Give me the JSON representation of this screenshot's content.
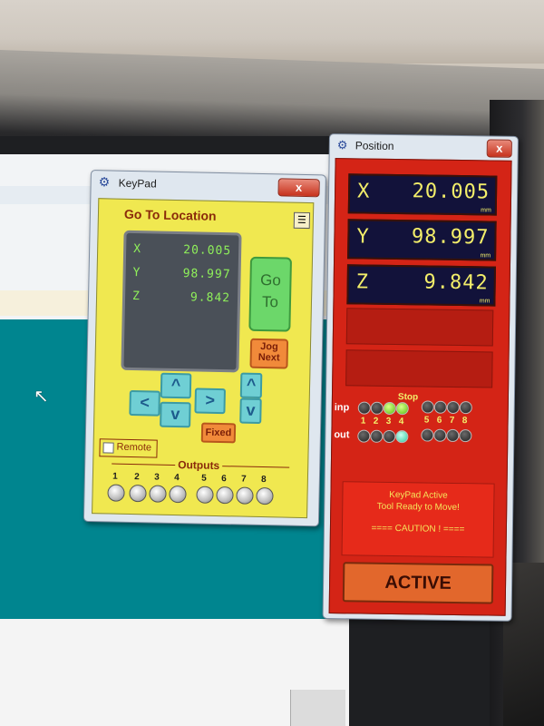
{
  "keypad": {
    "title": "KeyPad",
    "close_label": "x",
    "heading": "Go To Location",
    "display": [
      {
        "axis": "X",
        "value": "20.005"
      },
      {
        "axis": "Y",
        "value": "98.997"
      },
      {
        "axis": "Z",
        "value": "9.842"
      }
    ],
    "goto_line1": "Go",
    "goto_line2": "To",
    "jog_line1": "Jog",
    "jog_line2": "Next",
    "left_arrow": "<",
    "right_arrow": ">",
    "up_arrow": "^",
    "down_arrow": "v",
    "fixed_label": "Fixed",
    "remote_label": "Remote",
    "outputs_label": "Outputs",
    "outputs": [
      "1",
      "2",
      "3",
      "4",
      "5",
      "6",
      "7",
      "8"
    ]
  },
  "position": {
    "title": "Position",
    "close_label": "x",
    "rows": [
      {
        "axis": "X",
        "value": "20.005",
        "unit": "mm"
      },
      {
        "axis": "Y",
        "value": "98.997",
        "unit": "mm"
      },
      {
        "axis": "Z",
        "value": "9.842",
        "unit": "mm"
      }
    ],
    "stop_label": "Stop",
    "inp_label": "inp",
    "out_label": "out",
    "io_numbers": [
      "1",
      "2",
      "3",
      "4",
      "5",
      "6",
      "7",
      "8"
    ],
    "message_line1": "KeyPad Active",
    "message_line2": "Tool Ready to Move!",
    "message_line3": "==== CAUTION ! ====",
    "active_label": "ACTIVE",
    "colors": {
      "panel": "#d42416",
      "digits": "#f3ee6a"
    }
  },
  "colors": {
    "keypad_panel": "#f0e850",
    "desktop": "#00858f"
  }
}
